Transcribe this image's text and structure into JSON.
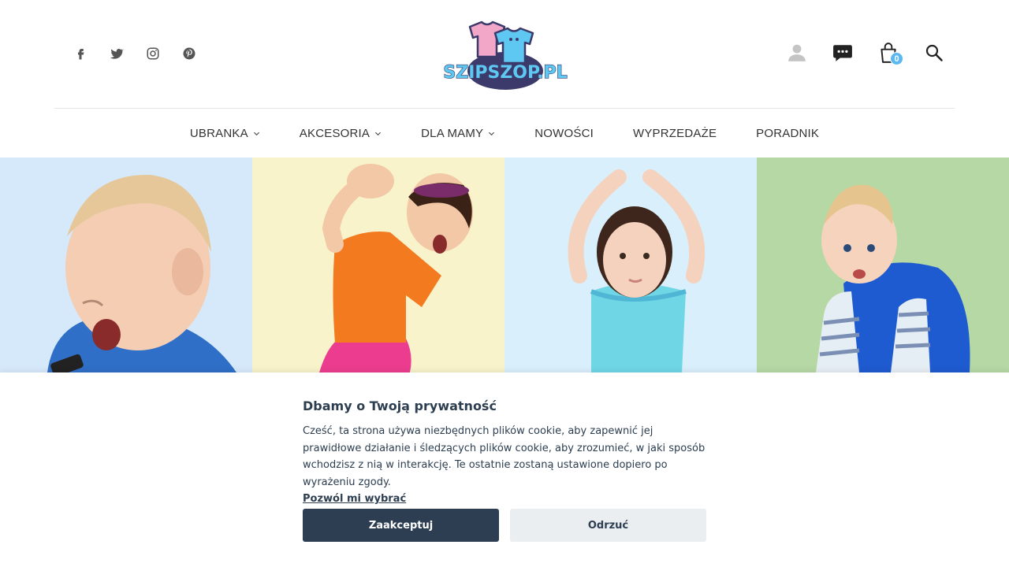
{
  "header": {
    "social_icons": [
      "facebook-icon",
      "twitter-icon",
      "instagram-icon",
      "pinterest-icon"
    ],
    "logo_text": "SZIPSZOP.PL",
    "actions": {
      "account_icon": "user-icon",
      "chat_icon": "chat-icon",
      "cart_icon": "cart-icon",
      "cart_count": "0",
      "search_icon": "search-icon"
    }
  },
  "nav": {
    "items": [
      {
        "label": "UBRANKA",
        "dropdown": true
      },
      {
        "label": "AKCESORIA",
        "dropdown": true
      },
      {
        "label": "DLA MAMY",
        "dropdown": true
      },
      {
        "label": "NOWOŚCI",
        "dropdown": false
      },
      {
        "label": "WYPRZEDAŻE",
        "dropdown": false
      },
      {
        "label": "PORADNIK",
        "dropdown": false
      }
    ]
  },
  "hero": {
    "tiles": [
      {
        "bg": "#d6e9fa"
      },
      {
        "bg": "#f9f3cb"
      },
      {
        "bg": "#d9effb"
      },
      {
        "bg": "#b6d8a4"
      }
    ]
  },
  "cookie": {
    "title": "Dbamy o Twoją prywatność",
    "text": "Cześć, ta strona używa niezbędnych plików cookie, aby zapewnić jej prawidłowe działanie i śledzących plików cookie, aby zrozumieć, w jaki sposób wchodzisz z nią w interakcję. Te ostatnie zostaną ustawione dopiero po wyrażeniu zgody.",
    "link": "Pozwól mi wybrać",
    "accept_label": "Zaakceptuj",
    "reject_label": "Odrzuć"
  },
  "colors": {
    "primary_dark": "#2d3e52",
    "badge": "#5bb8f0",
    "logo_pink": "#f2a7c8",
    "logo_blue": "#5ec8f2",
    "logo_navy": "#3b3a6b"
  }
}
